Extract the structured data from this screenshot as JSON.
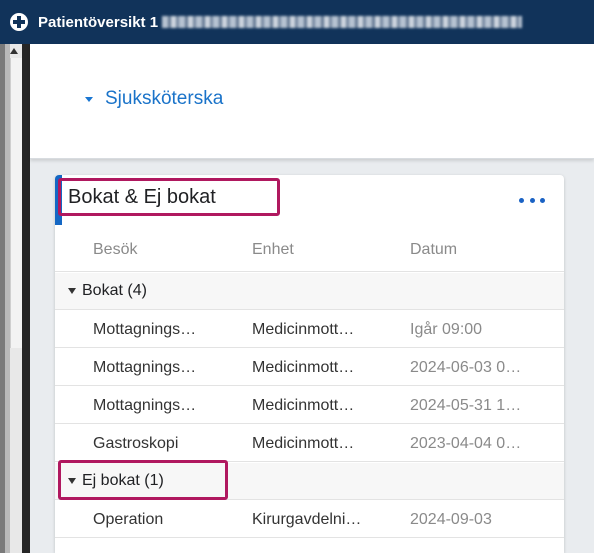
{
  "window": {
    "title": "Patientöversikt 1",
    "title_icon": "cross-plus-icon"
  },
  "section": {
    "label": "Sjuksköterska",
    "icon": "caret-down-icon"
  },
  "card": {
    "title": "Bokat & Ej bokat",
    "more_icon": "more-horizontal-icon",
    "columns": [
      "Besök",
      "Enhet",
      "Datum"
    ],
    "groups": [
      {
        "label": "Bokat (4)",
        "rows": [
          {
            "besok": "Mottagnings…",
            "enhet": "Medicinmott…",
            "datum": "Igår 09:00"
          },
          {
            "besok": "Mottagnings…",
            "enhet": "Medicinmott…",
            "datum": "2024-06-03 0…"
          },
          {
            "besok": "Mottagnings…",
            "enhet": "Medicinmott…",
            "datum": "2024-05-31 1…"
          },
          {
            "besok": "Gastroskopi",
            "enhet": "Medicinmott…",
            "datum": "2023-04-04 0…"
          }
        ]
      },
      {
        "label": "Ej bokat (1)",
        "rows": [
          {
            "besok": "Operation",
            "enhet": "Kirurgavdelni…",
            "datum": "2024-09-03"
          }
        ]
      }
    ]
  },
  "colors": {
    "titlebar": "#11335a",
    "accent": "#1467c4",
    "link": "#1a73c9",
    "highlight_box": "#b0185f"
  }
}
